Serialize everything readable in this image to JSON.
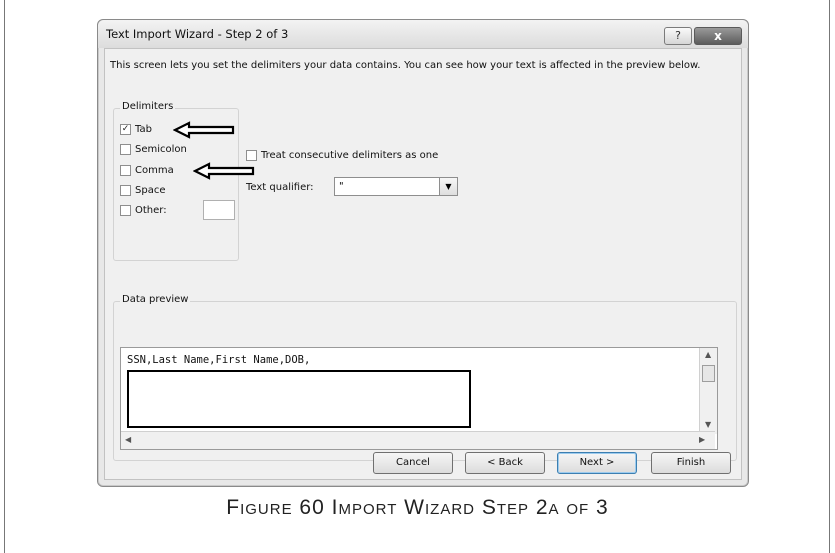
{
  "dialog": {
    "title": "Text Import Wizard - Step 2 of 3",
    "help_label": "?",
    "close_label": "x"
  },
  "description": "This screen lets you set the delimiters your data contains.  You can see how your text is affected in the preview below.",
  "delimiters": {
    "group_label": "Delimiters",
    "items": [
      {
        "label": "Tab",
        "checked": true
      },
      {
        "label": "Semicolon",
        "checked": false
      },
      {
        "label": "Comma",
        "checked": false
      },
      {
        "label": "Space",
        "checked": false
      },
      {
        "label": "Other:",
        "checked": false
      }
    ],
    "other_value": ""
  },
  "consecutive": {
    "label": "Treat consecutive delimiters as one",
    "checked": false
  },
  "qualifier": {
    "label": "Text qualifier:",
    "value": "\""
  },
  "preview": {
    "group_label": "Data preview",
    "line": "SSN,Last Name,First Name,DOB,"
  },
  "buttons": {
    "cancel": "Cancel",
    "back": "< Back",
    "next": "Next >",
    "finish": "Finish"
  },
  "caption": "Figure 60 Import Wizard Step 2a of 3",
  "icons": {
    "check": "✓",
    "dropdown": "▼",
    "scroll_up": "▲",
    "scroll_down": "▼",
    "scroll_left": "◀",
    "scroll_right": "▶"
  }
}
